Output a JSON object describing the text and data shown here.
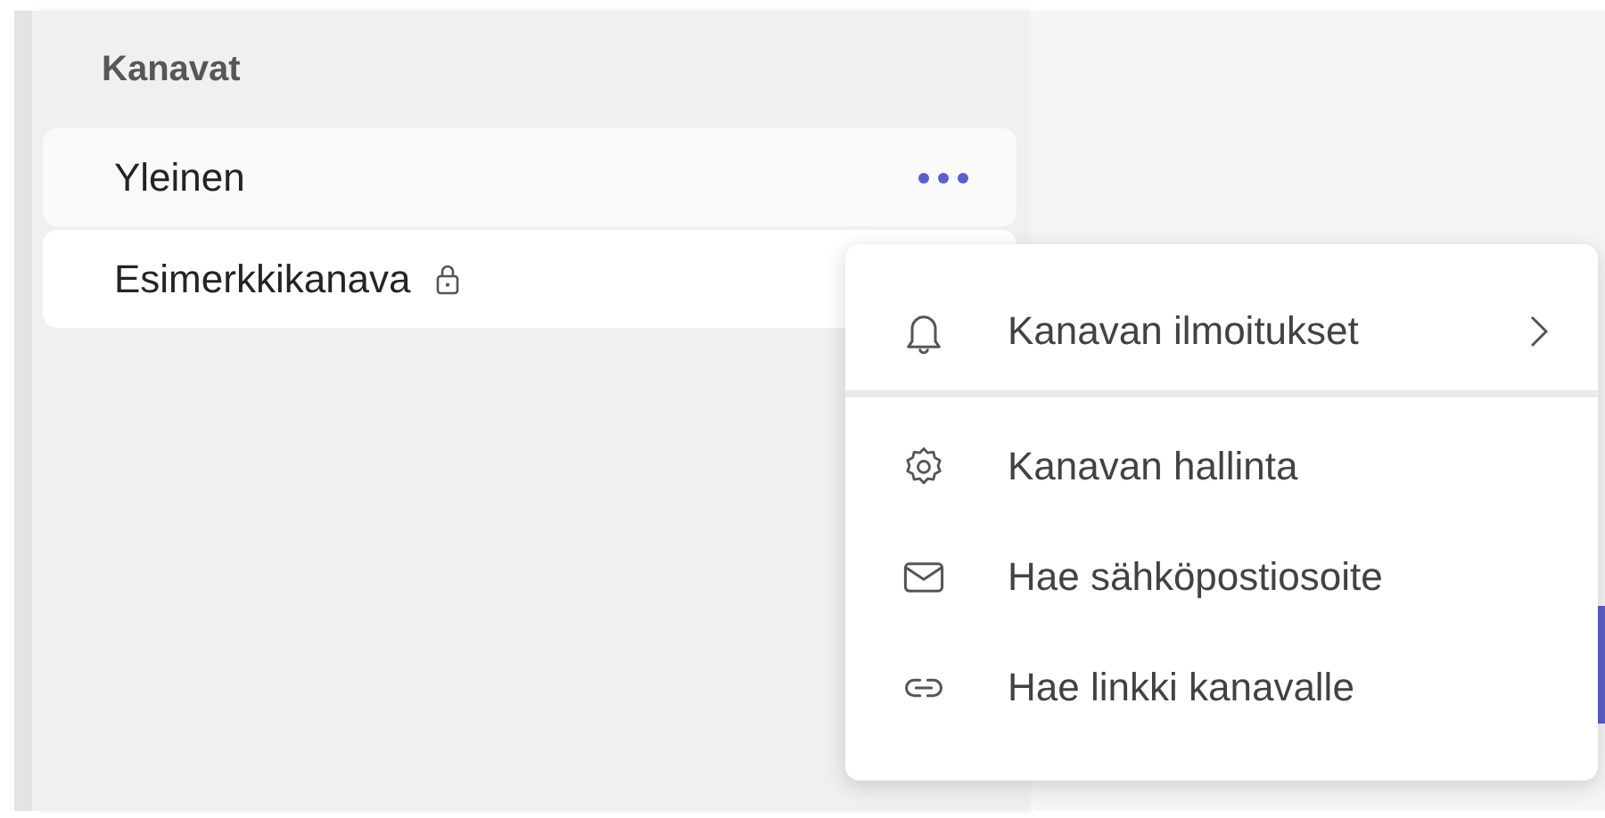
{
  "sidebar": {
    "title": "Kanavat",
    "channels": [
      {
        "name": "Yleinen",
        "selected": false,
        "hovered": true,
        "private": false
      },
      {
        "name": "Esimerkkikanava",
        "selected": true,
        "hovered": false,
        "private": true
      }
    ]
  },
  "context_menu": {
    "items": [
      {
        "kind": "notifications",
        "label": "Kanavan ilmoitukset",
        "submenu": true,
        "divider_after": true
      },
      {
        "kind": "settings",
        "label": "Kanavan hallinta",
        "submenu": false,
        "divider_after": false
      },
      {
        "kind": "email",
        "label": "Hae sähköpostiosoite",
        "submenu": false,
        "divider_after": false
      },
      {
        "kind": "link",
        "label": "Hae linkki kanavalle",
        "submenu": false,
        "divider_after": false
      }
    ]
  }
}
